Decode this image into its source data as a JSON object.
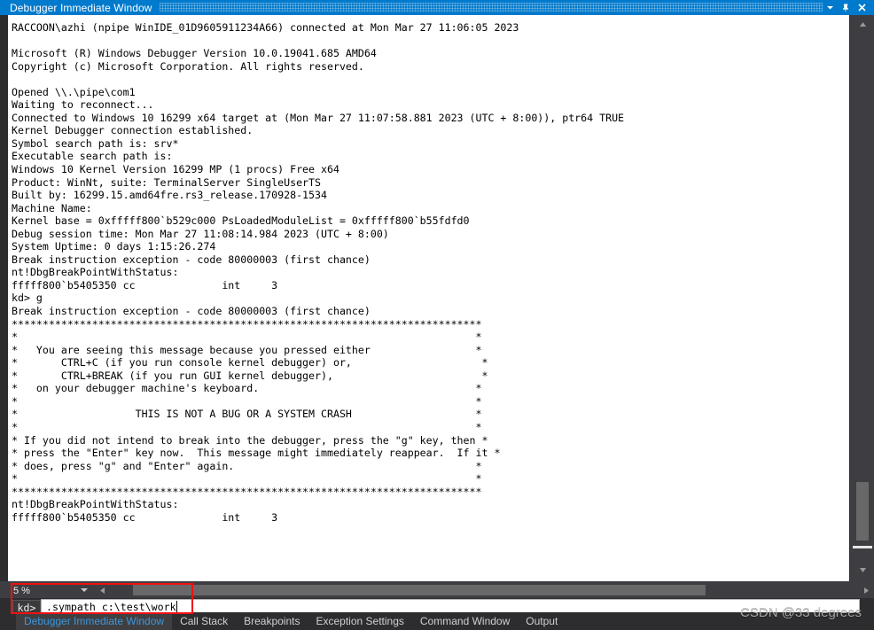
{
  "window": {
    "title": "Debugger Immediate Window",
    "icons": {
      "dropdown": "chevron-down-icon",
      "pin": "pin-icon",
      "close": "close-icon"
    }
  },
  "console": {
    "lines": [
      "RACCOON\\azhi (npipe WinIDE_01D9605911234A66) connected at Mon Mar 27 11:06:05 2023",
      "",
      "Microsoft (R) Windows Debugger Version 10.0.19041.685 AMD64",
      "Copyright (c) Microsoft Corporation. All rights reserved.",
      "",
      "Opened \\\\.\\pipe\\com1",
      "Waiting to reconnect...",
      "Connected to Windows 10 16299 x64 target at (Mon Mar 27 11:07:58.881 2023 (UTC + 8:00)), ptr64 TRUE",
      "Kernel Debugger connection established.",
      "Symbol search path is: srv*",
      "Executable search path is:",
      "Windows 10 Kernel Version 16299 MP (1 procs) Free x64",
      "Product: WinNt, suite: TerminalServer SingleUserTS",
      "Built by: 16299.15.amd64fre.rs3_release.170928-1534",
      "Machine Name:",
      "Kernel base = 0xfffff800`b529c000 PsLoadedModuleList = 0xfffff800`b55fdfd0",
      "Debug session time: Mon Mar 27 11:08:14.984 2023 (UTC + 8:00)",
      "System Uptime: 0 days 1:15:26.274",
      "Break instruction exception - code 80000003 (first chance)",
      "nt!DbgBreakPointWithStatus:",
      "fffff800`b5405350 cc              int     3",
      "kd> g",
      "Break instruction exception - code 80000003 (first chance)",
      "****************************************************************************",
      "*                                                                          *",
      "*   You are seeing this message because you pressed either                 *",
      "*       CTRL+C (if you run console kernel debugger) or,                     *",
      "*       CTRL+BREAK (if you run GUI kernel debugger),                        *",
      "*   on your debugger machine's keyboard.                                   *",
      "*                                                                          *",
      "*                   THIS IS NOT A BUG OR A SYSTEM CRASH                    *",
      "*                                                                          *",
      "* If you did not intend to break into the debugger, press the \"g\" key, then *",
      "* press the \"Enter\" key now.  This message might immediately reappear.  If it *",
      "* does, press \"g\" and \"Enter\" again.                                       *",
      "*                                                                          *",
      "****************************************************************************",
      "nt!DbgBreakPointWithStatus:",
      "fffff800`b5405350 cc              int     3"
    ]
  },
  "zoom_control": {
    "value": "5 %",
    "caret_icon": "chevron-down-icon"
  },
  "scrollbars": {
    "vertical": {
      "up_icon": "scroll-up-arrow-icon",
      "down_icon": "scroll-down-arrow-icon"
    },
    "horizontal": {
      "left_icon": "scroll-left-arrow-icon",
      "right_icon": "scroll-right-arrow-icon"
    }
  },
  "command": {
    "prompt": "kd>",
    "value": ".sympath c:\\test\\work"
  },
  "tabs": [
    {
      "label": "Debugger Immediate Window",
      "active": true
    },
    {
      "label": "Call Stack",
      "active": false
    },
    {
      "label": "Breakpoints",
      "active": false
    },
    {
      "label": "Exception Settings",
      "active": false
    },
    {
      "label": "Command Window",
      "active": false
    },
    {
      "label": "Output",
      "active": false
    }
  ],
  "watermark": {
    "text": "CSDN @33 degrees"
  },
  "colors": {
    "accent": "#007acc",
    "active_tab_text": "#3a96dd",
    "chrome": "#2d2d30",
    "scrollbar_track": "#3e3e42",
    "scrollbar_thumb": "#686868",
    "highlight_box": "#ee1111",
    "console_bg": "#ffffff",
    "console_text": "#000000"
  }
}
